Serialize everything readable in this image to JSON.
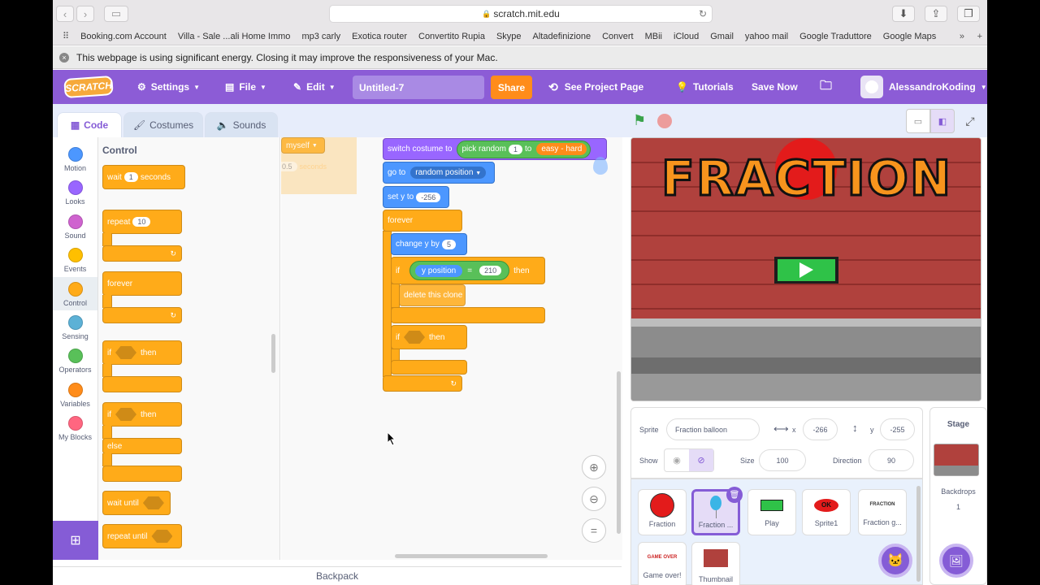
{
  "browser": {
    "url": "scratch.mit.edu",
    "bookmarks": [
      "Booking.com Account",
      "Villa - Sale ...ali Home Immo",
      "mp3 carly",
      "Exotica router",
      "Convertito Rupia",
      "Skype",
      "Altadefinizione",
      "Convert",
      "MBii",
      "iCloud",
      "Gmail",
      "yahoo mail",
      "Google Traduttore",
      "Google Maps"
    ],
    "energy_warning": "This webpage is using significant energy. Closing it may improve the responsiveness of your Mac."
  },
  "menu": {
    "logo": "SCRATCH",
    "settings": "Settings",
    "file": "File",
    "edit": "Edit",
    "project_title": "Untitled-7",
    "share": "Share",
    "see_project_page": "See Project Page",
    "tutorials": "Tutorials",
    "save_now": "Save Now",
    "username": "AlessandroKoding"
  },
  "tabs": {
    "code": "Code",
    "costumes": "Costumes",
    "sounds": "Sounds"
  },
  "categories": [
    {
      "label": "Motion",
      "color": "#4c97ff"
    },
    {
      "label": "Looks",
      "color": "#9966ff"
    },
    {
      "label": "Sound",
      "color": "#cf63cf"
    },
    {
      "label": "Events",
      "color": "#ffbf00"
    },
    {
      "label": "Control",
      "color": "#ffab19"
    },
    {
      "label": "Sensing",
      "color": "#5cb1d6"
    },
    {
      "label": "Operators",
      "color": "#59c059"
    },
    {
      "label": "Variables",
      "color": "#ff8c1a"
    },
    {
      "label": "My Blocks",
      "color": "#ff6680"
    }
  ],
  "palette": {
    "heading": "Control",
    "wait": "wait",
    "wait_value": "1",
    "seconds": "seconds",
    "repeat": "repeat",
    "repeat_value": "10",
    "forever": "forever",
    "if": "if",
    "then": "then",
    "else": "else",
    "wait_until": "wait until",
    "repeat_until": "repeat until"
  },
  "ghost_blocks": {
    "myself": "myself",
    "value": "0.5",
    "seconds": "seconds"
  },
  "script": {
    "switch_costume": "switch costume to",
    "pick_random": "pick random",
    "random_from": "1",
    "to": "to",
    "costume_value": "easy - hard",
    "go_to": "go to",
    "random_position": "random position",
    "set_y": "set y to",
    "set_y_value": "-256",
    "forever": "forever",
    "change_y": "change y by",
    "change_y_value": "5",
    "if1": "if",
    "y_position": "y position",
    "equals": "=",
    "compare_value": "210",
    "then1": "then",
    "delete_clone": "delete this clone",
    "if2": "if",
    "then2": "then"
  },
  "stage": {
    "title": "FRACTION"
  },
  "sprite_info": {
    "sprite_label": "Sprite",
    "sprite_name": "Fraction balloon",
    "x_label": "x",
    "x": "-266",
    "y_label": "y",
    "y": "-255",
    "show_label": "Show",
    "size_label": "Size",
    "size": "100",
    "direction_label": "Direction",
    "direction": "90"
  },
  "sprites": [
    {
      "name": "Fraction",
      "selected": false
    },
    {
      "name": "Fraction ...",
      "selected": true
    },
    {
      "name": "Play",
      "selected": false
    },
    {
      "name": "Sprite1",
      "selected": false
    },
    {
      "name": "Fraction g...",
      "selected": false
    },
    {
      "name": "Game over!",
      "selected": false
    },
    {
      "name": "Thumbnail",
      "selected": false
    }
  ],
  "sprite_thumbs": {
    "ok": "OK",
    "fraction": "FRACTION",
    "game_over": "GAME OVER"
  },
  "stage_panel": {
    "label": "Stage",
    "backdrops_label": "Backdrops",
    "backdrops_count": "1"
  },
  "backpack": "Backpack"
}
